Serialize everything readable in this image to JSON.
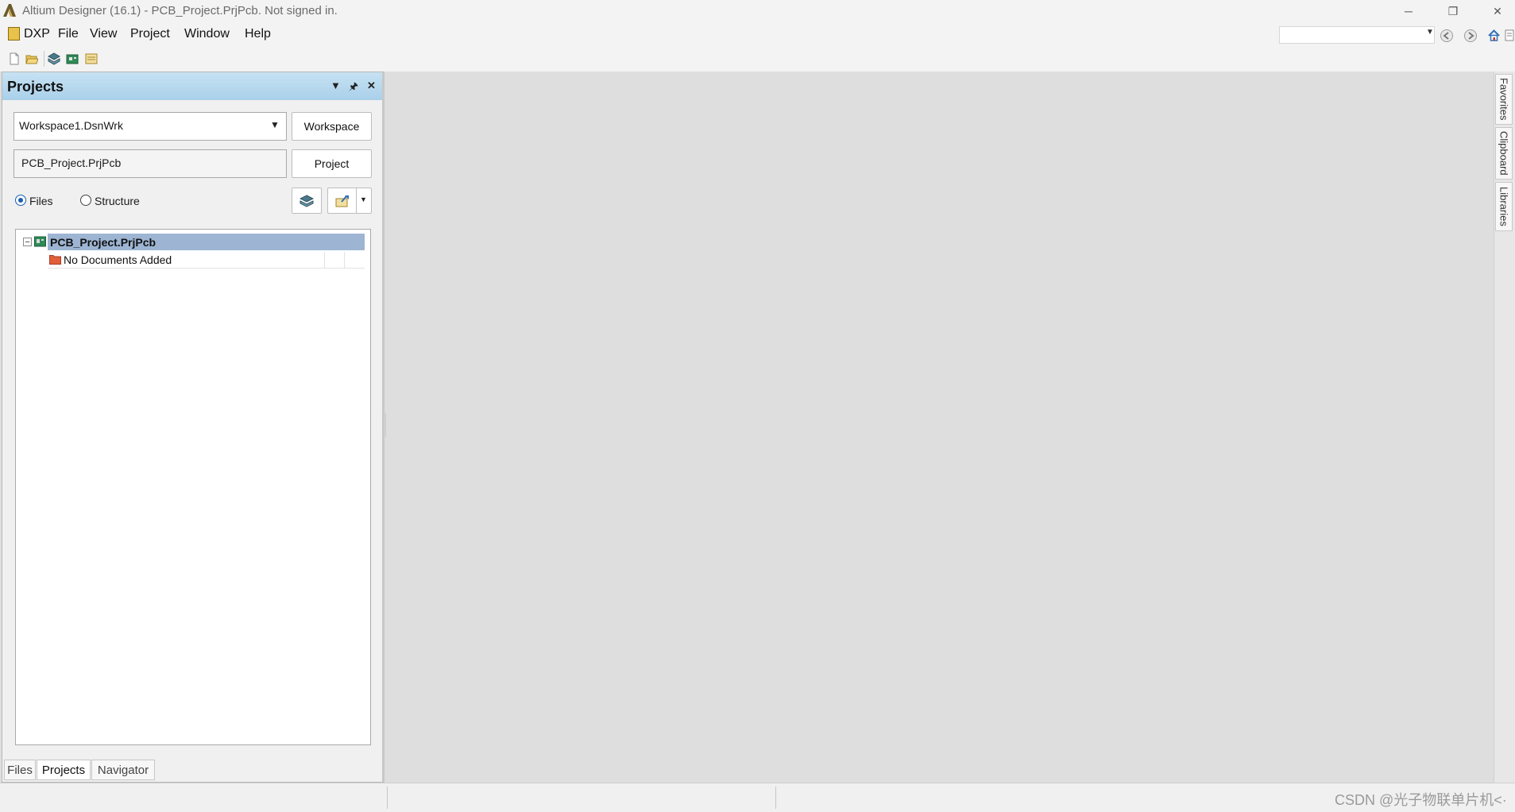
{
  "window": {
    "title": "Altium Designer (16.1) - PCB_Project.PrjPcb. Not signed in.",
    "minimize_glyph": "─",
    "restore_glyph": "❐",
    "close_glyph": "✕"
  },
  "menu": {
    "items": [
      {
        "label": "DXP"
      },
      {
        "label": "File"
      },
      {
        "label": "View"
      },
      {
        "label": "Project"
      },
      {
        "label": "Window"
      },
      {
        "label": "Help"
      }
    ],
    "search_value": ""
  },
  "panel": {
    "title": "Projects",
    "workspace_combo": "Workspace1.DsnWrk",
    "workspace_button": "Workspace",
    "project_field": "PCB_Project.PrjPcb",
    "project_button": "Project",
    "radio_files": "Files",
    "radio_structure": "Structure",
    "tree": {
      "root": "PCB_Project.PrjPcb",
      "child": "No Documents Added",
      "expander": "⊟"
    },
    "tabs": [
      {
        "label": "Files"
      },
      {
        "label": "Projects"
      },
      {
        "label": "Navigator"
      }
    ]
  },
  "side_tabs": [
    {
      "label": "Favorites"
    },
    {
      "label": "Clipboard"
    },
    {
      "label": "Libraries"
    }
  ],
  "watermark": "CSDN @光子物联单片机<·",
  "colors": {
    "panel_header": "#a9d0ea",
    "selection": "#9db5d3",
    "radio_accent": "#1a5fb4"
  }
}
